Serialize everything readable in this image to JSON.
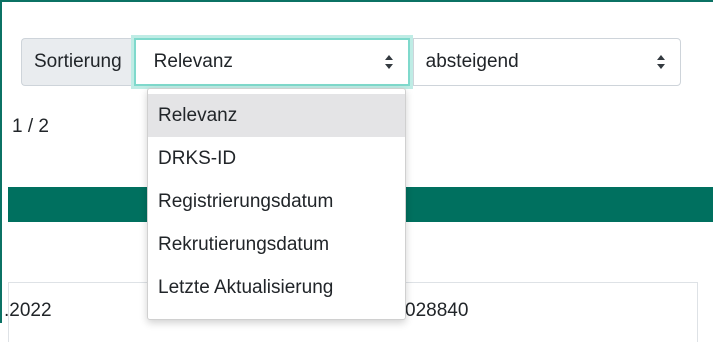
{
  "sort": {
    "label": "Sortierung",
    "field_value": "Relevanz",
    "order_value": "absteigend"
  },
  "dropdown": {
    "options": [
      "Relevanz",
      "DRKS-ID",
      "Registrierungsdatum",
      "Rekrutierungsdatum",
      "Letzte Aktualisierung"
    ],
    "selected_index": 0
  },
  "pagination": {
    "text": "1 / 2"
  },
  "result": {
    "date_fragment": ".2022",
    "id_fragment": "028840"
  },
  "colors": {
    "accent": "#00705f",
    "focus_ring": "#7fd9cc"
  }
}
